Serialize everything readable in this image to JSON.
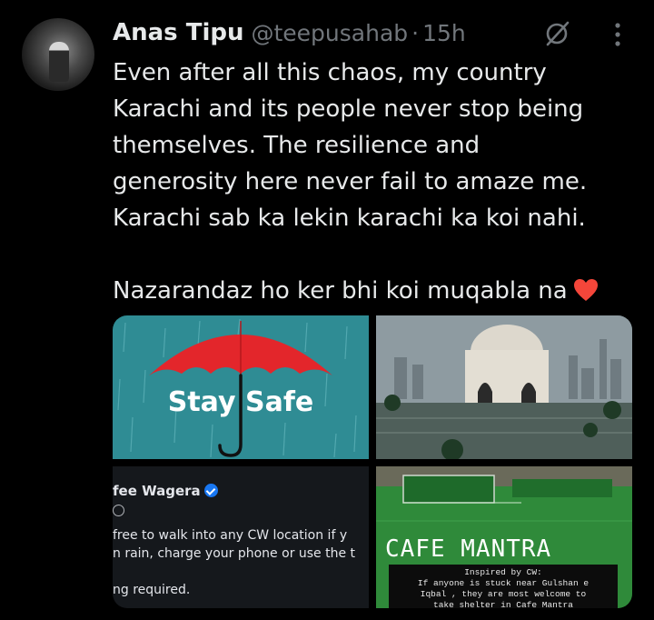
{
  "tweet": {
    "author_name": "Anas Tipu",
    "handle": "@teepusahab",
    "separator": "·",
    "time": "15h",
    "text": "Even after all this chaos, my country\nKarachi and its people never stop being\nthemselves. The resilience and\ngenerosity here never fail to amaze me.\nKarachi sab ka lekin karachi ka koi nahi.\n\nNazarandaz ho ker bhi koi muqabla na",
    "emoji": "red-heart-icon"
  },
  "media": {
    "image1": {
      "text": "Stay Safe",
      "icon": "umbrella-icon"
    },
    "image2": {
      "icon": "flooded-monument-image"
    },
    "image3": {
      "page_name": "fee Wagera",
      "line1": "free to walk into any CW location if y",
      "line2": "n rain, charge your phone or use the t",
      "line3": "ng required."
    },
    "image4": {
      "title": "CAFE MANTRA",
      "note": "Inspired by CW:\nIf anyone is stuck near Gulshan e\nIqbal , they are most welcome to\ntake shelter in Cafe Mantra"
    }
  },
  "colors": {
    "background": "#000000",
    "text": "#e7e9ea",
    "secondary": "#71767b",
    "accent": "#1d9bf0"
  }
}
